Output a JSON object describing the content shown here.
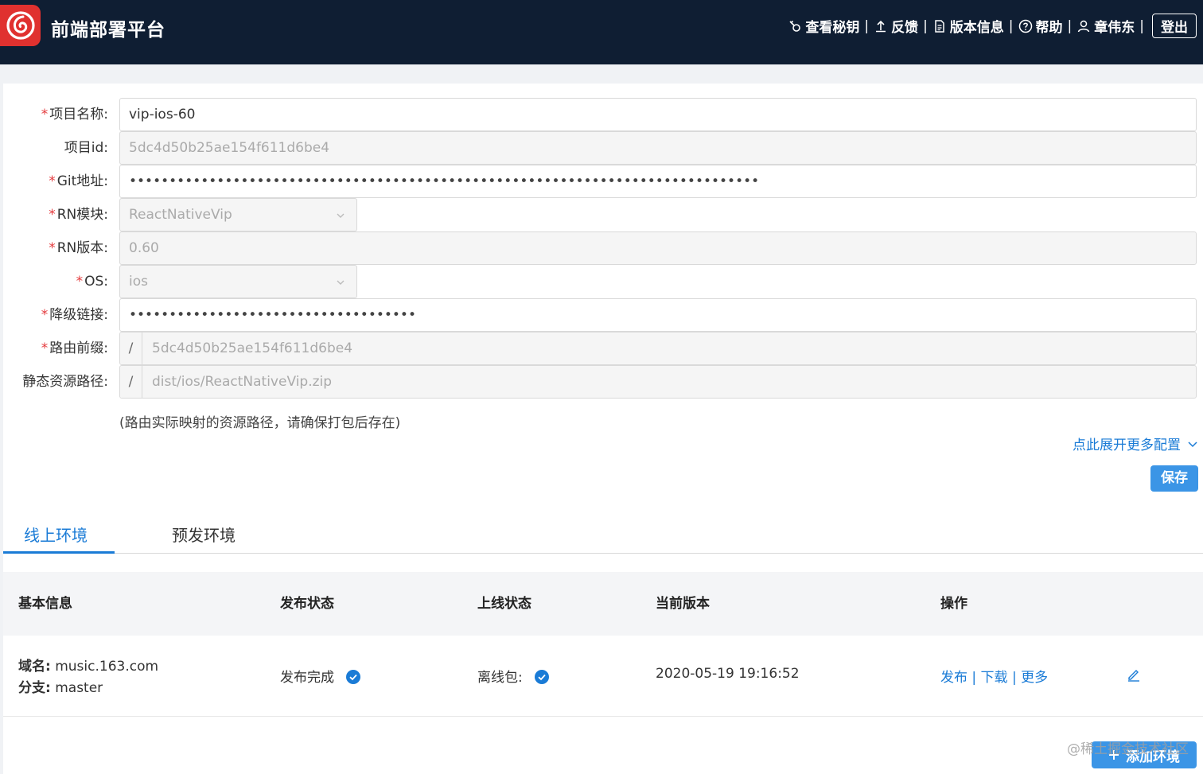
{
  "header": {
    "title": "前端部署平台",
    "nav": [
      {
        "label": "查看秘钥",
        "icon": "key-icon"
      },
      {
        "label": "反馈",
        "icon": "upload-icon"
      },
      {
        "label": "版本信息",
        "icon": "document-icon"
      },
      {
        "label": "帮助",
        "icon": "help-icon"
      },
      {
        "label": "章伟东",
        "icon": "user-icon"
      }
    ],
    "separator": "|",
    "logout": "登出"
  },
  "form": {
    "project_name": {
      "label": "项目名称:",
      "required": "*",
      "value": "vip-ios-60"
    },
    "project_id": {
      "label": "项目id:",
      "value": "5dc4d50b25ae154f611d6be4"
    },
    "git": {
      "label": "Git地址:",
      "required": "*",
      "value": "•••••••••••••••••••••••••••••••••••••••••••••••••••••••••••••••••••••••••••••••"
    },
    "rn_module": {
      "label": "RN模块:",
      "required": "*",
      "value": "ReactNativeVip"
    },
    "rn_version": {
      "label": "RN版本:",
      "required": "*",
      "value": "0.60"
    },
    "os": {
      "label": "OS:",
      "required": "*",
      "value": "ios"
    },
    "fallback": {
      "label": "降级链接:",
      "required": "*",
      "value": "••••••••••••••••••••••••••••••••••••"
    },
    "route_prefix": {
      "label": "路由前缀:",
      "required": "*",
      "addon": "/",
      "value": "5dc4d50b25ae154f611d6be4"
    },
    "static_path": {
      "label": "静态资源路径:",
      "addon": "/",
      "value": "dist/ios/ReactNativeVip.zip"
    },
    "hint": "(路由实际映射的资源路径，请确保打包后存在)",
    "expand": "点此展开更多配置",
    "save": "保存"
  },
  "tabs": [
    {
      "label": "线上环境",
      "active": true
    },
    {
      "label": "预发环境",
      "active": false
    }
  ],
  "table": {
    "headers": [
      "基本信息",
      "发布状态",
      "上线状态",
      "当前版本",
      "操作"
    ],
    "row": {
      "domain_key": "域名:",
      "domain": "music.163.com",
      "branch_key": "分支:",
      "branch": "master",
      "publish_status": "发布完成",
      "online_status": "离线包:",
      "version": "2020-05-19 19:16:52",
      "actions": "发布 | 下载 | 更多"
    }
  },
  "add_env": "添加环境",
  "watermark": "@稀土掘金技术社区",
  "colors": {
    "header_bg": "#0f1e33",
    "brand": "#e0312f",
    "primary": "#1a7bd6",
    "required": "#e4393c"
  }
}
